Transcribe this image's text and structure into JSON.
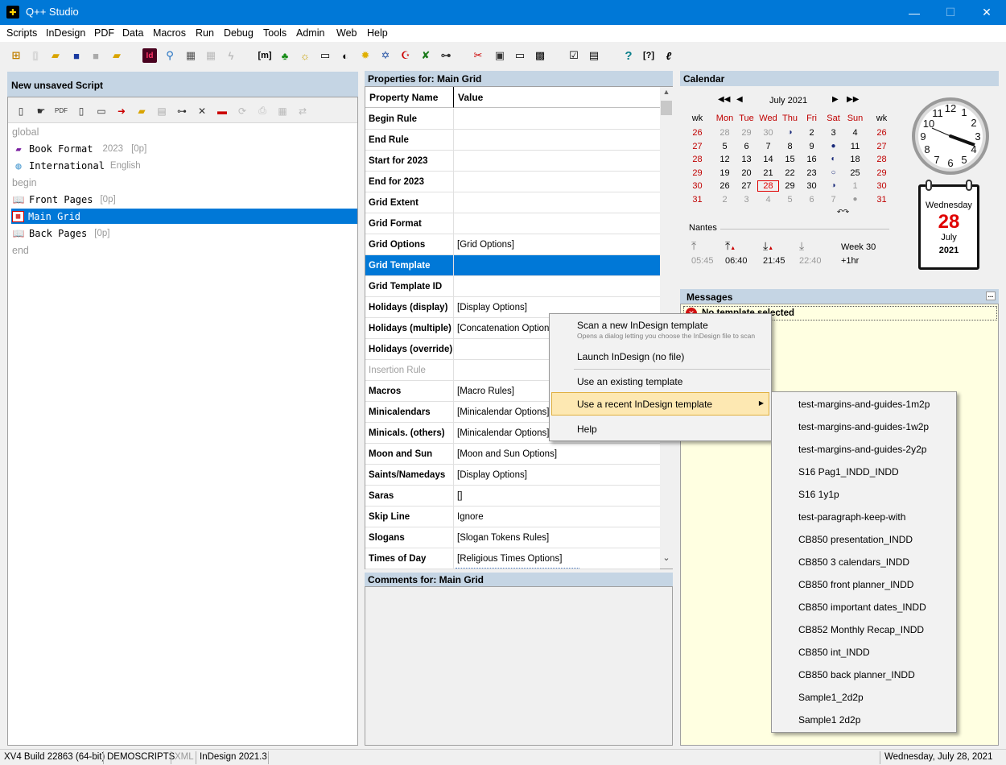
{
  "window": {
    "title": "Q++ Studio"
  },
  "menu": [
    "Scripts",
    "InDesign",
    "PDF",
    "Data",
    "Macros",
    "Run",
    "Debug",
    "Tools",
    "Admin",
    "Web",
    "Help"
  ],
  "script": {
    "header": "New unsaved Script",
    "tree": [
      {
        "label": "global",
        "kind": "keyword"
      },
      {
        "label": "Book Format",
        "extra1": "2023",
        "extra2": "[0p]",
        "icon": "book-icon"
      },
      {
        "label": "International",
        "extra1": "English",
        "extra2": "",
        "icon": "globe-icon"
      },
      {
        "label": "begin",
        "kind": "keyword"
      },
      {
        "label": "Front Pages",
        "extra1": "",
        "extra2": "[0p]",
        "icon": "open-book-icon"
      },
      {
        "label": "Main Grid",
        "extra1": "",
        "extra2": "",
        "icon": "calendar-grid-icon",
        "selected": true
      },
      {
        "label": "Back Pages",
        "extra1": "",
        "extra2": "[0p]",
        "icon": "open-book-icon"
      },
      {
        "label": "end",
        "kind": "keyword"
      }
    ]
  },
  "properties": {
    "header": "Properties for: Main Grid",
    "col_name": "Property Name",
    "col_value": "Value",
    "rows": [
      {
        "name": "Begin Rule",
        "value": ""
      },
      {
        "name": "End Rule",
        "value": ""
      },
      {
        "name": "Start for 2023",
        "value": ""
      },
      {
        "name": "End for 2023",
        "value": ""
      },
      {
        "name": "Grid Extent",
        "value": ""
      },
      {
        "name": "Grid Format",
        "value": ""
      },
      {
        "name": "Grid Options",
        "value": "[Grid Options]"
      },
      {
        "name": "Grid Template",
        "value": ""
      },
      {
        "name": "Grid Template ID",
        "value": ""
      },
      {
        "name": "Holidays (display)",
        "value": "[Display Options]"
      },
      {
        "name": "Holidays (multiple)",
        "value": "[Concatenation Options]"
      },
      {
        "name": "Holidays (override)",
        "value": ""
      },
      {
        "name": "Insertion Rule",
        "value": ""
      },
      {
        "name": "Macros",
        "value": "[Macro Rules]"
      },
      {
        "name": "Minicalendars",
        "value": "[Minicalendar Options]"
      },
      {
        "name": "Minicals. (others)",
        "value": "[Minicalendar Options]"
      },
      {
        "name": "Moon and Sun",
        "value": "[Moon and Sun Options]"
      },
      {
        "name": "Saints/Namedays",
        "value": "[Display Options]"
      },
      {
        "name": "Saras",
        "value": "[]"
      },
      {
        "name": "Skip Line",
        "value": "Ignore"
      },
      {
        "name": "Slogans",
        "value": "[Slogan Tokens Rules]"
      },
      {
        "name": "Times of Day",
        "value": "[Religious Times Options]"
      }
    ]
  },
  "comments": {
    "header": "Comments for: Main Grid"
  },
  "calendar": {
    "header": "Calendar",
    "month": "July 2021",
    "wk_label": "wk",
    "days": [
      "Mon",
      "Tue",
      "Wed",
      "Thu",
      "Fri",
      "Sat",
      "Sun"
    ],
    "weeks": [
      {
        "wk": "26",
        "d": [
          "28",
          "29",
          "30",
          "◑",
          "2",
          "3",
          "4"
        ],
        "wk2": "26"
      },
      {
        "wk": "27",
        "d": [
          "5",
          "6",
          "7",
          "8",
          "9",
          "●",
          "11"
        ],
        "wk2": "27"
      },
      {
        "wk": "28",
        "d": [
          "12",
          "13",
          "14",
          "15",
          "16",
          "◐",
          "18"
        ],
        "wk2": "28"
      },
      {
        "wk": "29",
        "d": [
          "19",
          "20",
          "21",
          "22",
          "23",
          "○",
          "25"
        ],
        "wk2": "29"
      },
      {
        "wk": "30",
        "d": [
          "26",
          "27",
          "28",
          "29",
          "30",
          "◑",
          "1"
        ],
        "wk2": "30"
      },
      {
        "wk": "31",
        "d": [
          "2",
          "3",
          "4",
          "5",
          "6",
          "7",
          "●"
        ],
        "wk2": "31"
      }
    ],
    "city": "Nantes",
    "sun": [
      {
        "time": "05:45",
        "icon": "twilight-rise-icon"
      },
      {
        "time": "06:40",
        "icon": "sunrise-icon"
      },
      {
        "time": "21:45",
        "icon": "sunset-icon"
      },
      {
        "time": "22:40",
        "icon": "twilight-set-icon"
      }
    ],
    "week_label": "Week 30",
    "offset": "+1hr",
    "today": {
      "weekday": "Wednesday",
      "day": "28",
      "month": "July",
      "year": "2021"
    }
  },
  "messages": {
    "header": "Messages",
    "items": [
      "No template selected"
    ],
    "more": "..."
  },
  "context_menu": {
    "items": [
      {
        "label": "Scan a new InDesign template",
        "desc": "Opens a dialog letting you choose the InDesign file to scan"
      },
      {
        "label": "Launch InDesign (no file)"
      },
      {
        "label": "Use an existing template"
      },
      {
        "label": "Use a recent InDesign template"
      },
      {
        "label": "Help"
      }
    ],
    "submenu": [
      "test-margins-and-guides-1m2p",
      "test-margins-and-guides-1w2p",
      "test-margins-and-guides-2y2p",
      "S16 Pag1_INDD_INDD",
      "S16 1y1p",
      "test-paragraph-keep-with",
      "CB850 presentation_INDD",
      "CB850 3 calendars_INDD",
      "CB850 front planner_INDD",
      "CB850 important dates_INDD",
      "CB852 Monthly Recap_INDD",
      "CB850 int_INDD",
      "CB850 back planner_INDD",
      "Sample1_2d2p",
      "Sample1 2d2p"
    ]
  },
  "status": {
    "build": "XV4 Build 22863 (64-bit)",
    "db": "DEMOSCRIPTS",
    "xml": "XML",
    "indesign": "InDesign 2021.3",
    "date": "Wednesday, July 28, 2021"
  },
  "colors": {
    "titlebar": "#0078d7",
    "selection": "#0078d7",
    "panel_header": "#c5d5e4",
    "messages_bg": "#ffffe1",
    "today": "#e00000"
  }
}
